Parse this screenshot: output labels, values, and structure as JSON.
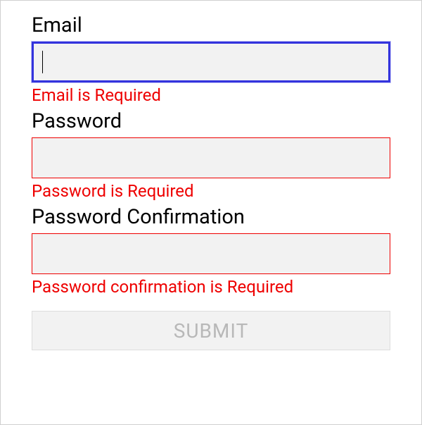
{
  "form": {
    "email": {
      "label": "Email",
      "value": "",
      "error": "Email is Required"
    },
    "password": {
      "label": "Password",
      "value": "",
      "error": "Password is Required"
    },
    "passwordConfirmation": {
      "label": "Password Confirmation",
      "value": "",
      "error": "Password confirmation is Required"
    },
    "submit": {
      "label": "SUBMIT"
    }
  },
  "colors": {
    "error": "#ee0000",
    "focus": "#3333dd",
    "inputBg": "#f2f2f2",
    "buttonText": "#b8b8b8"
  }
}
